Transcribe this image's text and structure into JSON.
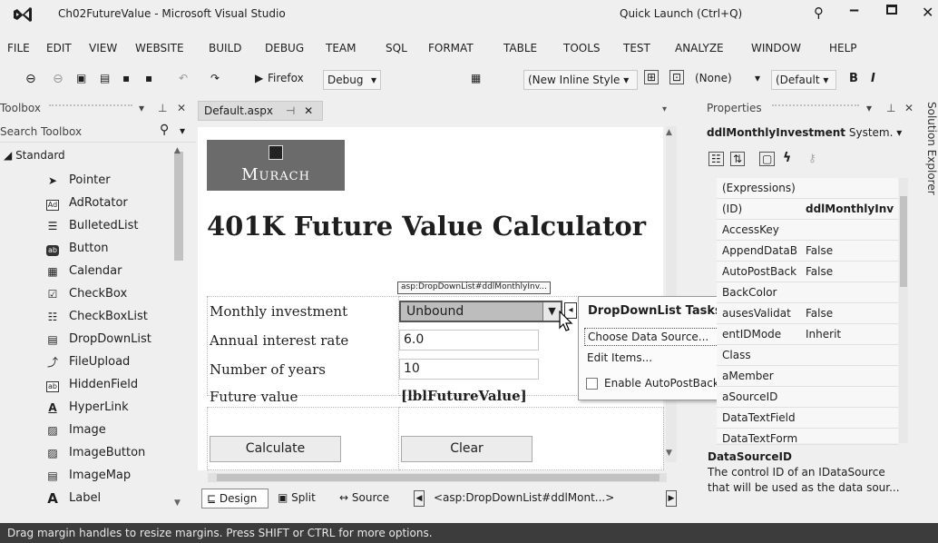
{
  "window": {
    "title": "Ch02FutureValue - Microsoft Visual Studio",
    "quick_launch": "Quick Launch (Ctrl+Q)"
  },
  "menu": [
    "FILE",
    "EDIT",
    "VIEW",
    "WEBSITE",
    "BUILD",
    "DEBUG",
    "TEAM",
    "SQL",
    "FORMAT",
    "TABLE",
    "TOOLS",
    "TEST",
    "ANALYZE",
    "WINDOW",
    "HELP"
  ],
  "toolbar": {
    "browser": "Firefox",
    "config": "Debug",
    "style": "(New Inline Style",
    "target": "(None)",
    "font": "(Default",
    "bold": "B",
    "italic": "I"
  },
  "toolbox": {
    "title": "Toolbox",
    "search_placeholder": "Search Toolbox",
    "group": "Standard",
    "items": [
      {
        "label": "Pointer",
        "icon": "pointer-icon"
      },
      {
        "label": "AdRotator",
        "icon": "adrotator-icon"
      },
      {
        "label": "BulletedList",
        "icon": "bulletedlist-icon"
      },
      {
        "label": "Button",
        "icon": "button-icon"
      },
      {
        "label": "Calendar",
        "icon": "calendar-icon"
      },
      {
        "label": "CheckBox",
        "icon": "checkbox-icon"
      },
      {
        "label": "CheckBoxList",
        "icon": "checkboxlist-icon"
      },
      {
        "label": "DropDownList",
        "icon": "dropdownlist-icon"
      },
      {
        "label": "FileUpload",
        "icon": "fileupload-icon"
      },
      {
        "label": "HiddenField",
        "icon": "hiddenfield-icon"
      },
      {
        "label": "HyperLink",
        "icon": "hyperlink-icon"
      },
      {
        "label": "Image",
        "icon": "image-icon"
      },
      {
        "label": "ImageButton",
        "icon": "imagebutton-icon"
      },
      {
        "label": "ImageMap",
        "icon": "imagemap-icon"
      },
      {
        "label": "Label",
        "icon": "label-icon"
      }
    ]
  },
  "editor": {
    "tab": "Default.aspx",
    "logo_text": "Murach",
    "heading": "401K Future Value Calculator",
    "smart_tag": "asp:DropDownList#ddlMonthlyInv...",
    "rows": [
      {
        "label": "Monthly investment",
        "value": "Unbound"
      },
      {
        "label": "Annual interest rate",
        "value": "6.0"
      },
      {
        "label": "Number of years",
        "value": "10"
      },
      {
        "label": "Future value",
        "value": "[lblFutureValue]"
      }
    ],
    "calculate": "Calculate",
    "clear": "Clear",
    "tasks": {
      "title": "DropDownList Tasks",
      "choose": "Choose Data Source...",
      "edit": "Edit Items...",
      "autopostback": "Enable AutoPostBack"
    },
    "views": {
      "design": "Design",
      "split": "Split",
      "source": "Source"
    },
    "tag_path": "<asp:DropDownList#ddlMont...>"
  },
  "properties": {
    "title": "Properties",
    "object": "ddlMonthlyInvestment",
    "object_type": "System.",
    "rows": [
      {
        "name": "(Expressions)",
        "value": "",
        "bold": false
      },
      {
        "name": "(ID)",
        "value": "ddlMonthlyInv",
        "bold": true
      },
      {
        "name": "AccessKey",
        "value": ""
      },
      {
        "name": "AppendDataB",
        "value": "False"
      },
      {
        "name": "AutoPostBack",
        "value": "False"
      },
      {
        "name": "BackColor",
        "value": ""
      },
      {
        "name": "ausesValidat",
        "value": "False"
      },
      {
        "name": "entIDMode",
        "value": "Inherit"
      },
      {
        "name": "Class",
        "value": ""
      },
      {
        "name": "aMember",
        "value": ""
      },
      {
        "name": "aSourceID",
        "value": ""
      },
      {
        "name": "DataTextField",
        "value": ""
      },
      {
        "name": "DataTextForm",
        "value": ""
      }
    ],
    "desc_title": "DataSourceID",
    "desc_text": "The control ID of an IDataSource that will be used as the data sour..."
  },
  "solution_explorer": "Solution Explorer",
  "status": "Drag margin handles to resize margins. Press SHIFT or CTRL for more options."
}
